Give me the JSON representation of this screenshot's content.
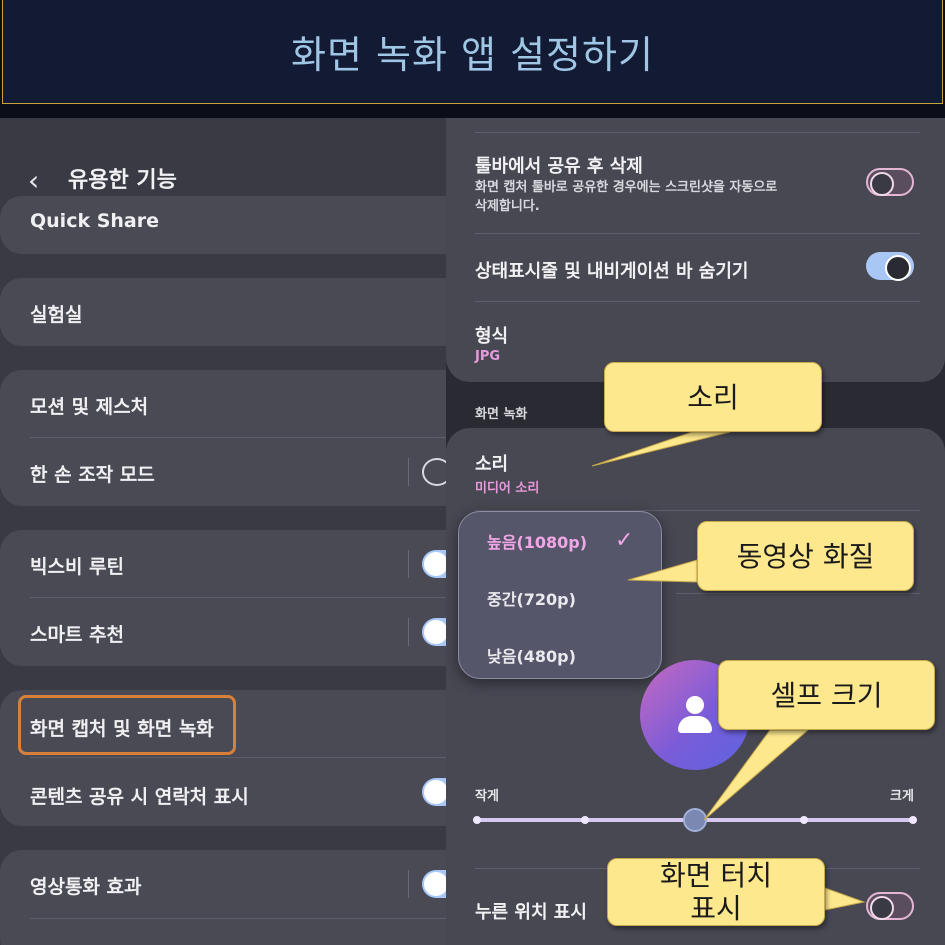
{
  "header": {
    "title": "화면 녹화 앱 설정하기"
  },
  "left": {
    "title": "유용한 기능",
    "items": [
      {
        "label": "Quick Share"
      },
      {
        "label": "실험실"
      },
      {
        "label": "모션 및 제스처"
      },
      {
        "label": "한 손 조작 모드"
      },
      {
        "label": "빅스비 루틴"
      },
      {
        "label": "스마트 추천"
      },
      {
        "label": "화면 캡처 및 화면 녹화"
      },
      {
        "label": "콘텐츠 공유 시 연락처 표시"
      },
      {
        "label": "영상통화 효과"
      }
    ]
  },
  "right": {
    "delete_after_share": {
      "title": "툴바에서 공유 후 삭제",
      "desc1": "화면 캡처 툴바로 공유한 경우에는 스크린샷을 자동으로",
      "desc2": "삭제합니다.",
      "state": "off"
    },
    "hide_bars": {
      "title": "상태표시줄 및 내비게이션 바 숨기기",
      "state": "on"
    },
    "format": {
      "title": "형식",
      "value": "JPG"
    },
    "section_label": "화면 녹화",
    "sound": {
      "title": "소리",
      "value": "미디어 소리"
    },
    "quality_options": [
      {
        "label": "높음(1080p)",
        "selected": true
      },
      {
        "label": "중간(720p)",
        "selected": false
      },
      {
        "label": "낮음(480p)",
        "selected": false
      }
    ],
    "selfie_size": {
      "min_label": "작게",
      "max_label": "크게",
      "steps": 5,
      "value_step": 3
    },
    "show_taps": {
      "title": "누른 위치 표시",
      "state": "off"
    }
  },
  "callouts": {
    "sound": "소리",
    "quality": "동영상 화질",
    "selfie": "셀프 크기",
    "touch_line1": "화면 터치",
    "touch_line2": "표시"
  },
  "colors": {
    "accent_pink": "#e79bdc",
    "toggle_on": "#a9c7f5",
    "callout_bg": "#fde88d",
    "highlight_border": "#d7803a"
  }
}
